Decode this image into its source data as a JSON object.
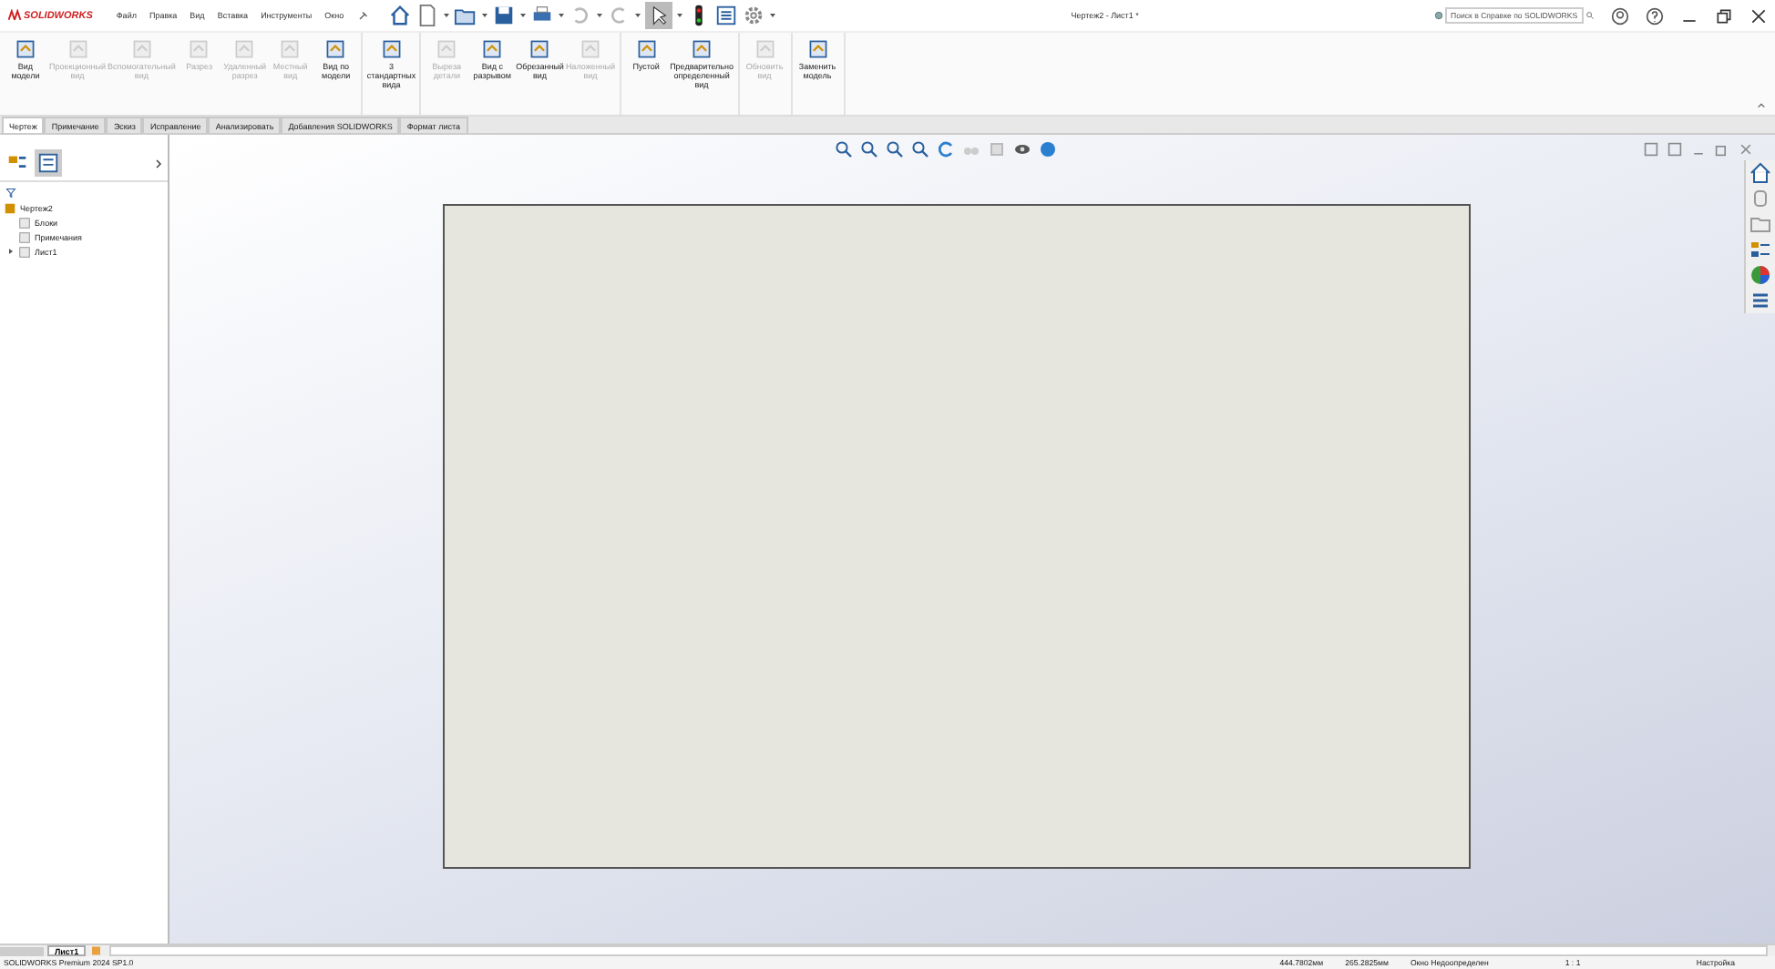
{
  "app": {
    "logo": "SOLIDWORKS",
    "menu": [
      "Файл",
      "Правка",
      "Вид",
      "Вставка",
      "Инструменты",
      "Окно"
    ],
    "title": "Чертеж2 - Лист1 *",
    "search": {
      "placeholder": "Поиск в Справке по SOLIDWORKS"
    }
  },
  "ribbon": {
    "groups": [
      [
        {
          "label": "Вид модели",
          "disabled": false
        },
        {
          "label": "Проекционный вид",
          "disabled": true
        },
        {
          "label": "Вспомогательный вид",
          "disabled": true
        },
        {
          "label": "Разрез",
          "disabled": true
        },
        {
          "label": "Удаленный разрез",
          "disabled": true
        },
        {
          "label": "Местный вид",
          "disabled": true
        },
        {
          "label": "Вид по модели",
          "disabled": false
        }
      ],
      [
        {
          "label": "3 стандартных вида",
          "disabled": false
        }
      ],
      [
        {
          "label": "Выреза детали",
          "disabled": true
        },
        {
          "label": "Вид с разрывом",
          "disabled": false
        },
        {
          "label": "Обрезанный вид",
          "disabled": false
        },
        {
          "label": "Наложенный вид",
          "disabled": true
        }
      ],
      [
        {
          "label": "Пустой",
          "disabled": false
        },
        {
          "label": "Предварительно определенный вид",
          "disabled": false
        }
      ],
      [
        {
          "label": "Обновить вид",
          "disabled": true
        }
      ],
      [
        {
          "label": "Заменить модель",
          "disabled": false
        }
      ]
    ]
  },
  "tabs": [
    {
      "label": "Чертеж",
      "selected": true
    },
    {
      "label": "Примечание",
      "selected": false
    },
    {
      "label": "Эскиз",
      "selected": false
    },
    {
      "label": "Исправление",
      "selected": false
    },
    {
      "label": "Анализировать",
      "selected": false
    },
    {
      "label": "Добавления SOLIDWORKS",
      "selected": false
    },
    {
      "label": "Формат листа",
      "selected": false
    }
  ],
  "tree": {
    "label": "Чертеж2",
    "children": [
      {
        "label": "Блоки"
      },
      {
        "label": "Примечания"
      },
      {
        "label": "Лист1",
        "expanded": false
      }
    ]
  },
  "sheet_tabs": [
    {
      "label": "Лист1",
      "selected": true
    }
  ],
  "status_bar": {
    "product": "SOLIDWORKS Premium 2024 SP1.0",
    "x": "444.7802мм",
    "y": "265.2825мм",
    "state": "Окно Недоопределен",
    "scale": "1 : 1",
    "units": "Настройка"
  }
}
